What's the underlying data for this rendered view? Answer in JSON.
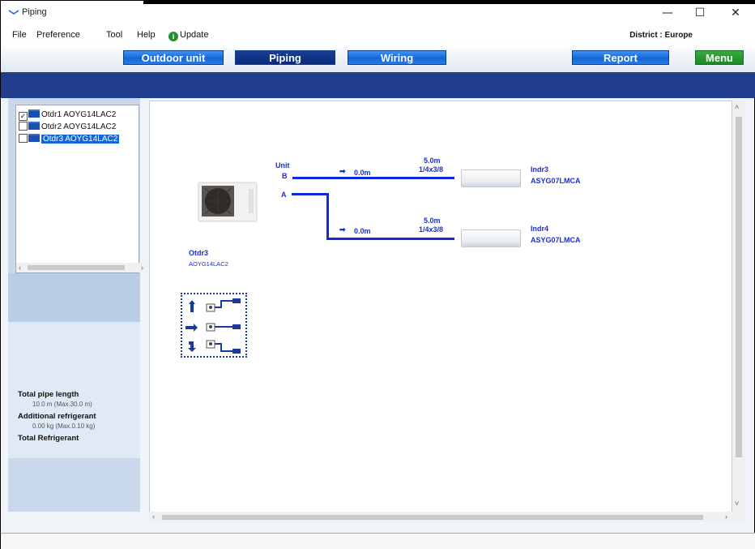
{
  "window": {
    "title": "Piping",
    "controls": [
      "—",
      "☐",
      "✕"
    ]
  },
  "menu": {
    "items": [
      "File",
      "Preference",
      "Tool",
      "Help"
    ],
    "update_label": "Update",
    "district": "District : Europe"
  },
  "toolbar": {
    "outdoor_unit": "Outdoor unit",
    "piping": "Piping",
    "wiring": "Wiring",
    "report": "Report",
    "menu": "Menu"
  },
  "tree": {
    "items": [
      {
        "label": "Otdr1 AOYG14LAC2",
        "checked": true,
        "selected": false
      },
      {
        "label": "Otdr2 AOYG14LAC2",
        "checked": false,
        "selected": false
      },
      {
        "label": "Otdr3 AOYG14LAC2",
        "checked": false,
        "selected": true
      }
    ]
  },
  "totals": {
    "pipe_length_label": "Total pipe length",
    "pipe_length_value": "10.0 m (Max.30.0 m)",
    "additional_label": "Additional refrigerant",
    "additional_value": "0.00 kg (Max.0.10 kg)",
    "total_label": "Total Refrigerant"
  },
  "diagram": {
    "outdoor_name": "Otdr3",
    "outdoor_model": "AOYG14LAC2",
    "unit_label": "Unit",
    "port_b": "B",
    "port_a": "A",
    "branches": [
      {
        "extra": "0.0m",
        "length": "5.0m",
        "spec": "1/4x3/8",
        "indoor_name": "Indr3",
        "indoor_model": "ASYG07LMCA"
      },
      {
        "extra": "0.0m",
        "length": "5.0m",
        "spec": "1/4x3/8",
        "indoor_name": "Indr4",
        "indoor_model": "ASYG07LMCA"
      }
    ]
  },
  "colors": {
    "navy": "#1f3d8c",
    "pipe": "#1027e0",
    "label_blue": "#1c2fd0"
  }
}
